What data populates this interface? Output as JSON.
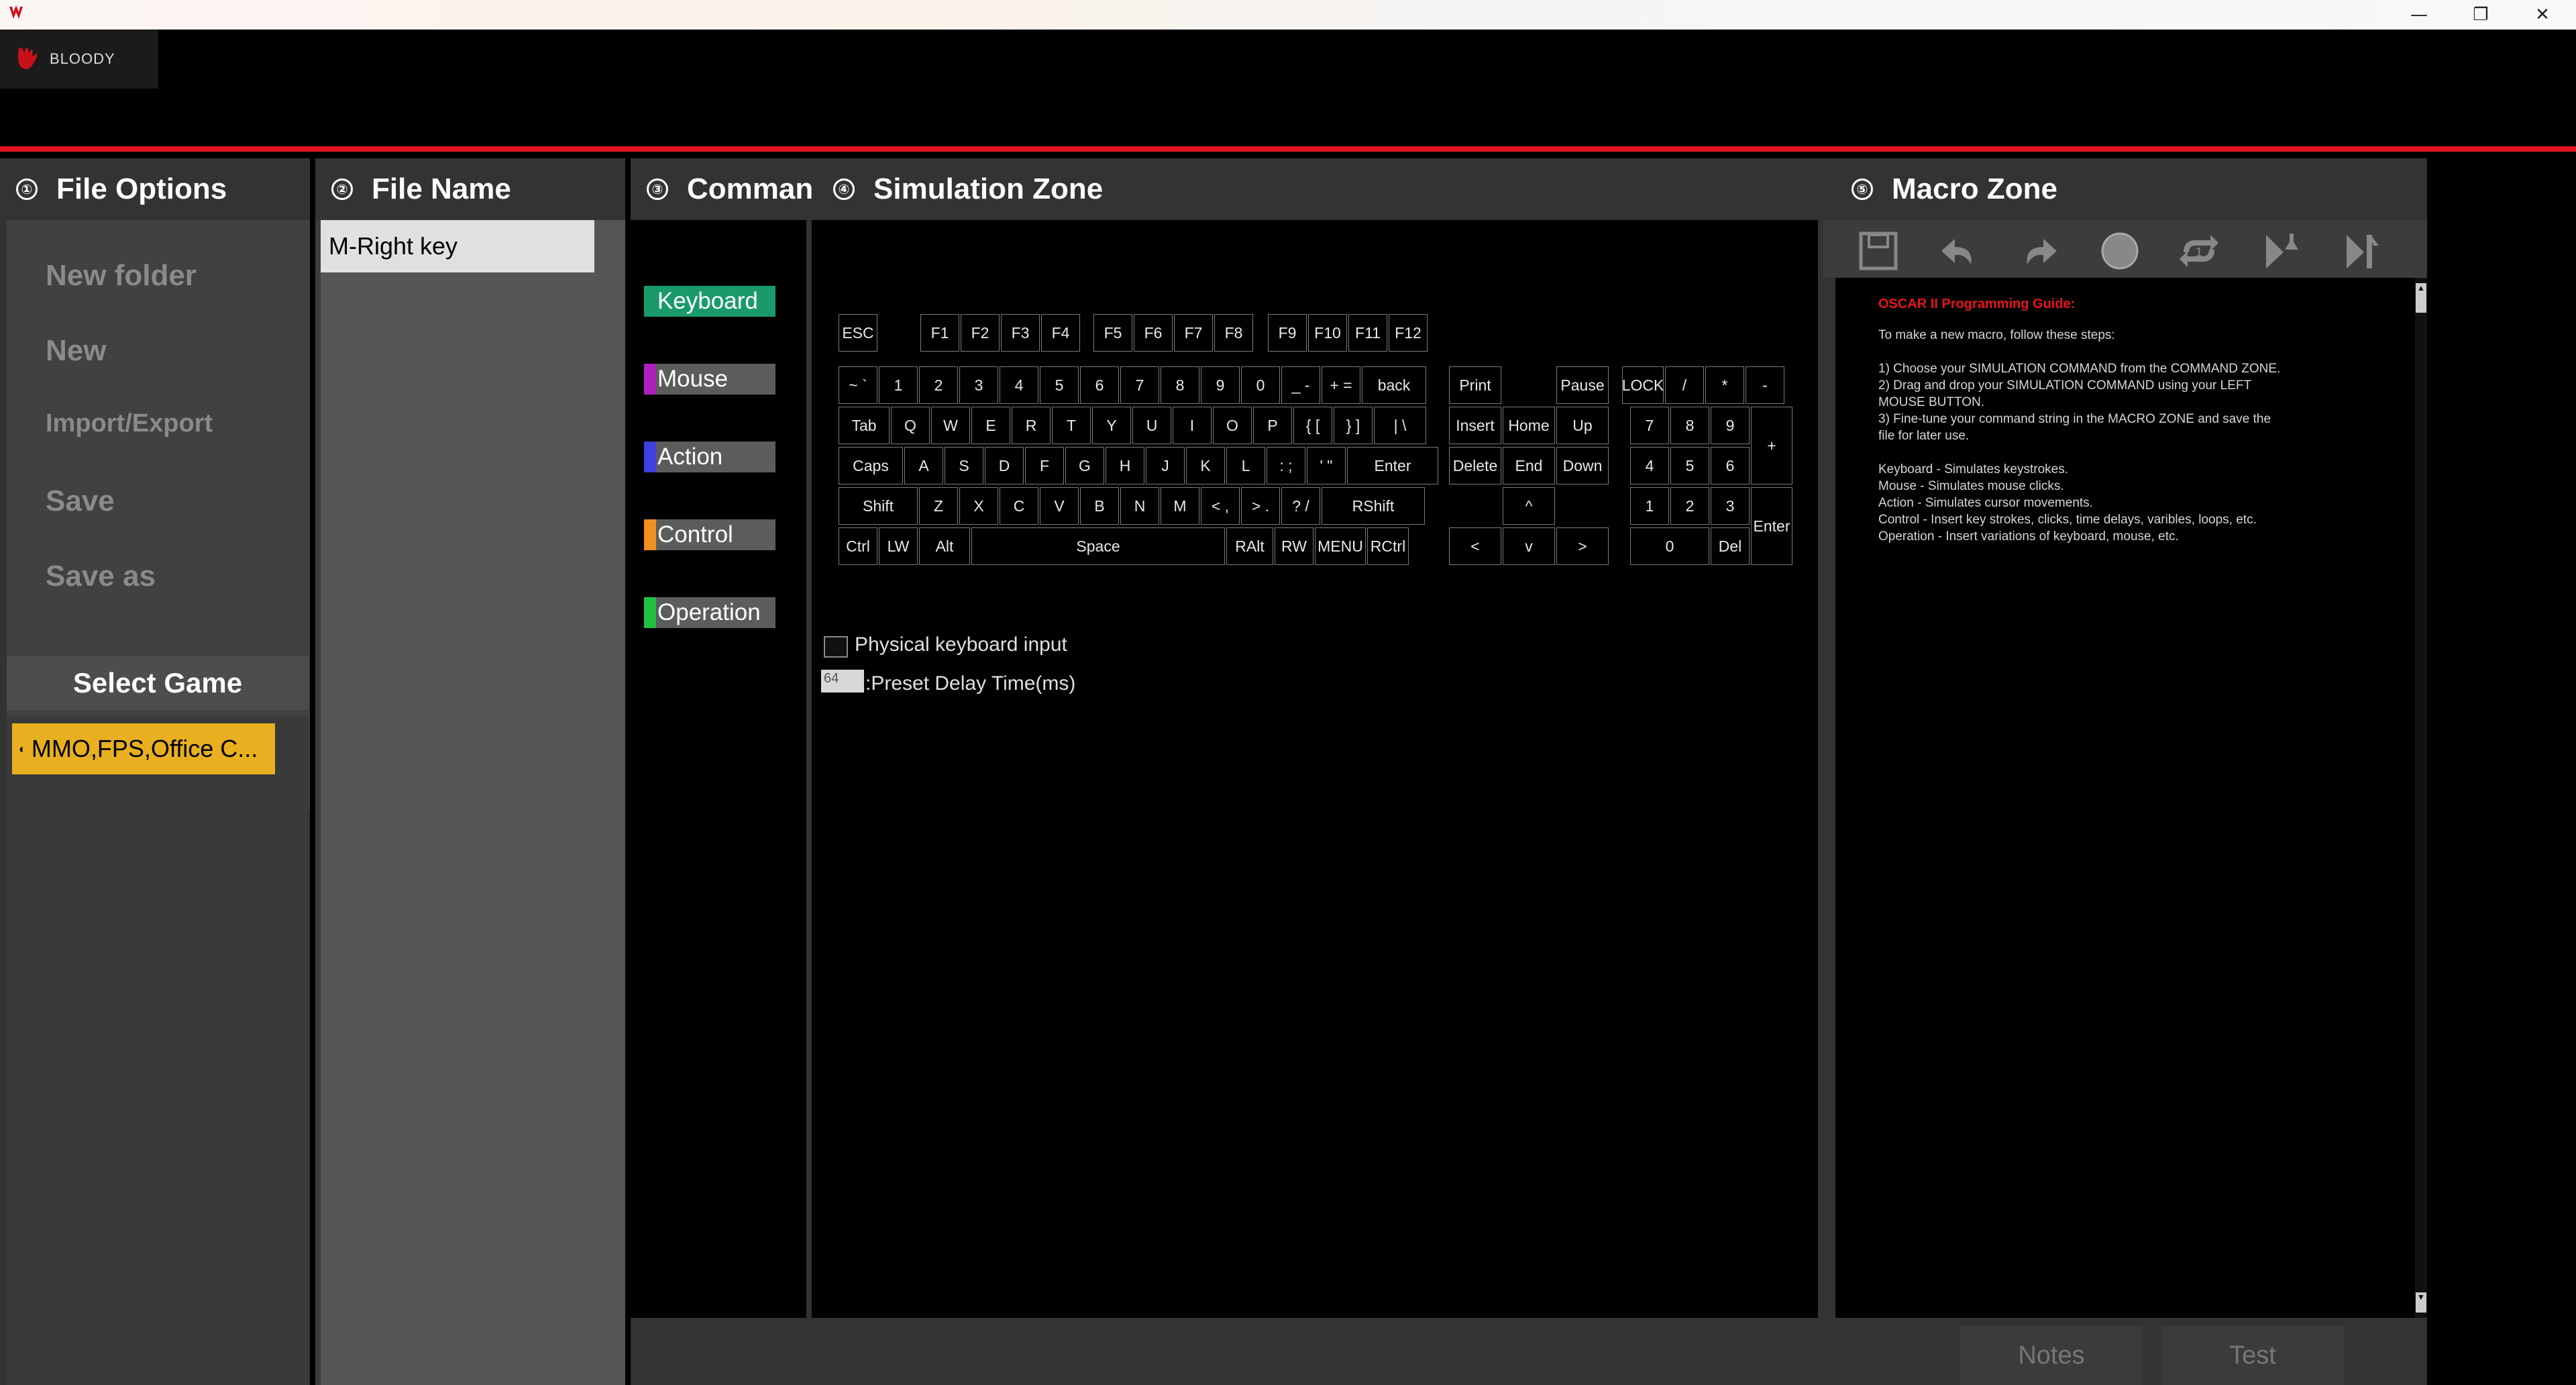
{
  "window": {
    "minimize": "—",
    "restore": "❐",
    "close": "✕"
  },
  "brand": {
    "name": "BLOODY",
    "colors": {
      "accent": "#e0141c"
    }
  },
  "panels": {
    "file_options": {
      "num": "①",
      "title": "File Options",
      "items": [
        "New folder",
        "New",
        "Import/Export",
        "Save",
        "Save as"
      ],
      "select_game": "Select Game",
      "game": "MMO,FPS,Office C..."
    },
    "file_name": {
      "num": "②",
      "title": "File Name",
      "current": "M-Right key"
    },
    "command": {
      "num": "③",
      "title": "Command",
      "items": [
        {
          "label": "Keyboard",
          "color": "#1a9a6a"
        },
        {
          "label": "Mouse",
          "color": "#b020c0"
        },
        {
          "label": "Action",
          "color": "#4040e0"
        },
        {
          "label": "Control",
          "color": "#f09020"
        },
        {
          "label": "Operation",
          "color": "#20c040"
        }
      ]
    },
    "simulation": {
      "num": "④",
      "title": "Simulation Zone",
      "physical_input": "Physical keyboard input",
      "delay_value": "64",
      "delay_label": ":Preset Delay Time(ms)"
    },
    "macro": {
      "num": "⑤",
      "title": "Macro Zone",
      "tools": [
        "save-icon",
        "undo-icon",
        "redo-icon",
        "record-icon",
        "loop-icon",
        "insert-icon",
        "insert-end-icon"
      ],
      "guide": {
        "heading": "OSCAR II Programming Guide:",
        "lines": [
          "To make a new macro, follow these steps:",
          "",
          "1) Choose your SIMULATION COMMAND from the COMMAND ZONE.",
          "2) Drag and drop your SIMULATION COMMAND using your LEFT",
          "MOUSE BUTTON.",
          "3) Fine-tune your command string in the MACRO ZONE and save the",
          "file for later use.",
          "",
          "Keyboard - Simulates keystrokes.",
          "Mouse - Simulates mouse clicks.",
          "Action - Simulates cursor movements.",
          "Control - Insert key strokes, clicks, time delays, varibles, loops, etc.",
          "Operation - Insert variations of keyboard, mouse, etc."
        ]
      }
    }
  },
  "keyboard": {
    "fn": [
      "ESC",
      "F1",
      "F2",
      "F3",
      "F4",
      "F5",
      "F6",
      "F7",
      "F8",
      "F9",
      "F10",
      "F11",
      "F12"
    ],
    "row1": [
      "~ `",
      "1",
      "2",
      "3",
      "4",
      "5",
      "6",
      "7",
      "8",
      "9",
      "0",
      "_ -",
      "+ =",
      "back"
    ],
    "row2": [
      "Tab",
      "Q",
      "W",
      "E",
      "R",
      "T",
      "Y",
      "U",
      "I",
      "O",
      "P",
      "{ [",
      "} ]",
      "| \\"
    ],
    "row3": [
      "Caps",
      "A",
      "S",
      "D",
      "F",
      "G",
      "H",
      "J",
      "K",
      "L",
      ": ;",
      "' \"",
      "Enter"
    ],
    "row4": [
      "Shift",
      "Z",
      "X",
      "C",
      "V",
      "B",
      "N",
      "M",
      "< ,",
      "> .",
      "? /",
      "RShift"
    ],
    "row5": [
      "Ctrl",
      "LW",
      "Alt",
      "Space",
      "RAlt",
      "RW",
      "MENU",
      "RCtrl"
    ],
    "nav": [
      "Print",
      "Pause",
      "Insert",
      "Home",
      "Up",
      "Delete",
      "End",
      "Down",
      "^",
      "<",
      "v",
      ">"
    ],
    "num": [
      "LOCK",
      "/",
      "*",
      "-",
      "7",
      "8",
      "9",
      "+",
      "4",
      "5",
      "6",
      "1",
      "2",
      "3",
      "Enter",
      "0",
      "Del"
    ]
  },
  "bottom": {
    "notes": "Notes",
    "test": "Test"
  }
}
